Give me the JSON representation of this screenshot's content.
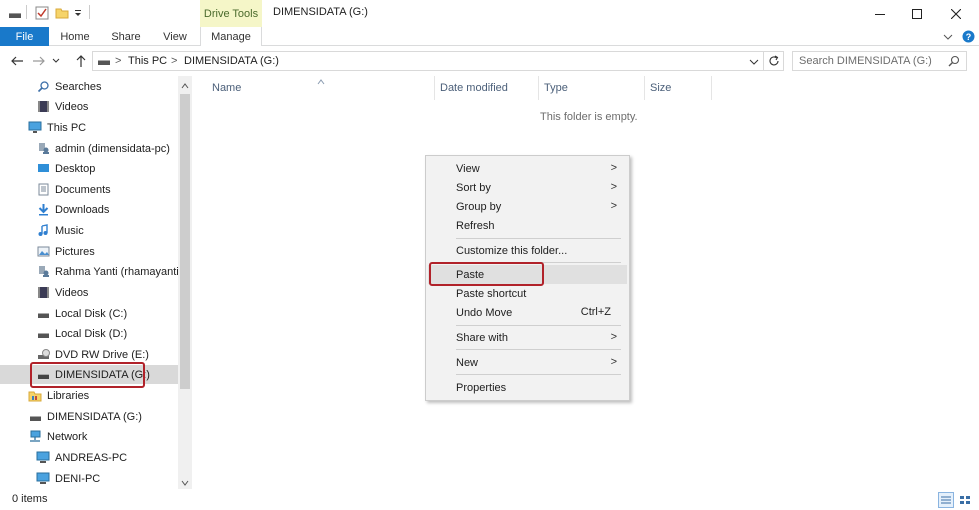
{
  "window": {
    "title": "DIMENSIDATA (G:)",
    "contextual_tab_group": "Drive Tools"
  },
  "ribbon": {
    "tabs": [
      {
        "label": "File"
      },
      {
        "label": "Home"
      },
      {
        "label": "Share"
      },
      {
        "label": "View"
      },
      {
        "label": "Manage"
      }
    ]
  },
  "address": {
    "breadcrumb": [
      "This PC",
      "DIMENSIDATA (G:)"
    ],
    "separator": ">"
  },
  "search": {
    "placeholder": "Search DIMENSIDATA (G:)"
  },
  "nav_pane": {
    "items": [
      {
        "label": "Searches",
        "icon": "search-icon"
      },
      {
        "label": "Videos",
        "icon": "videos-folder-icon"
      },
      {
        "label": "This PC",
        "icon": "computer-icon"
      },
      {
        "label": "admin (dimensidata-pc)",
        "icon": "user-folder-icon"
      },
      {
        "label": "Desktop",
        "icon": "desktop-icon"
      },
      {
        "label": "Documents",
        "icon": "documents-icon"
      },
      {
        "label": "Downloads",
        "icon": "downloads-icon"
      },
      {
        "label": "Music",
        "icon": "music-icon"
      },
      {
        "label": "Pictures",
        "icon": "pictures-icon"
      },
      {
        "label": "Rahma Yanti (rhamayanti)",
        "icon": "user-folder-icon"
      },
      {
        "label": "Videos",
        "icon": "videos-folder-icon"
      },
      {
        "label": "Local Disk (C:)",
        "icon": "drive-icon"
      },
      {
        "label": "Local Disk (D:)",
        "icon": "drive-icon"
      },
      {
        "label": "DVD RW Drive (E:)",
        "icon": "dvd-drive-icon"
      },
      {
        "label": "DIMENSIDATA (G:)",
        "icon": "drive-icon",
        "selected": true
      },
      {
        "label": "Libraries",
        "icon": "libraries-icon"
      },
      {
        "label": "DIMENSIDATA (G:)",
        "icon": "drive-icon"
      },
      {
        "label": "Network",
        "icon": "network-icon"
      },
      {
        "label": "ANDREAS-PC",
        "icon": "computer-icon"
      },
      {
        "label": "DENI-PC",
        "icon": "computer-icon"
      }
    ]
  },
  "content": {
    "columns": [
      "Name",
      "Date modified",
      "Type",
      "Size"
    ],
    "empty_message": "This folder is empty."
  },
  "context_menu": {
    "items": [
      {
        "label": "View",
        "submenu": true
      },
      {
        "label": "Sort by",
        "submenu": true
      },
      {
        "label": "Group by",
        "submenu": true
      },
      {
        "label": "Refresh"
      },
      {
        "label": "Customize this folder..."
      },
      {
        "label": "Paste",
        "hover": true
      },
      {
        "label": "Paste shortcut"
      },
      {
        "label": "Undo Move",
        "shortcut": "Ctrl+Z"
      },
      {
        "label": "Share with",
        "submenu": true
      },
      {
        "label": "New",
        "submenu": true
      },
      {
        "label": "Properties"
      }
    ],
    "submenu_arrow": ">"
  },
  "status_bar": {
    "text": "0 items"
  },
  "colors": {
    "accent": "#1979ca",
    "drive_tools_bg": "#f5f6c8",
    "highlight_box": "#b1222a"
  }
}
